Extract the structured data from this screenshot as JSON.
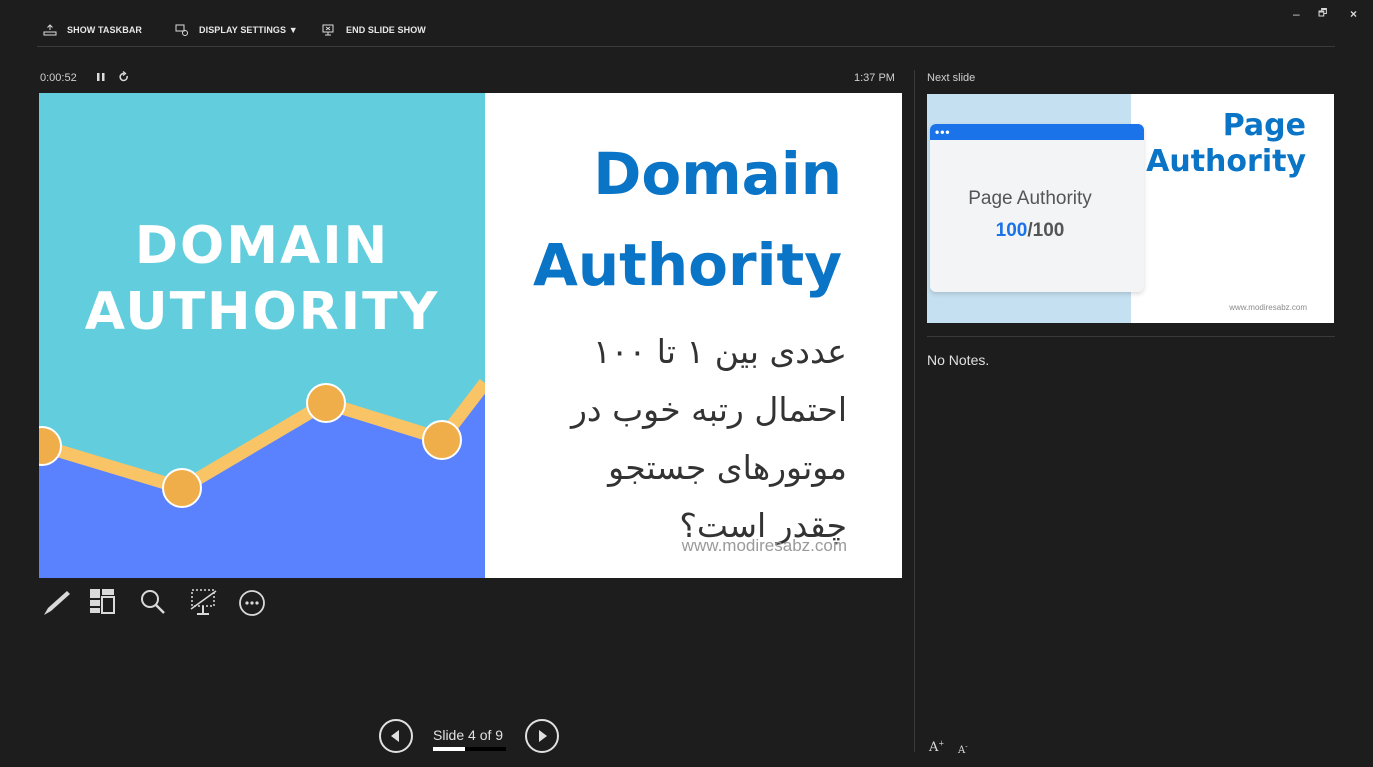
{
  "toolbar": {
    "show_taskbar": "SHOW TASKBAR",
    "display_settings": "DISPLAY SETTINGS ▼",
    "end_slide_show": "END SLIDE SHOW"
  },
  "window": {
    "minimize": "–",
    "restore": "🗗",
    "close": "×"
  },
  "presenter": {
    "elapsed": "0:00:52",
    "clock": "1:37 PM",
    "next_slide_label": "Next slide",
    "notes": "No Notes.",
    "slide_indicator": "Slide 4 of 9",
    "progress_fraction": 0.444
  },
  "current_slide": {
    "left_title_line1": "DOMAIN",
    "left_title_line2": "AUTHORITY",
    "right_title_line1": "Domain",
    "right_title_line2": "Authority",
    "fa_line1": "عددی بین ۱ تا ۱۰۰",
    "fa_line2": "احتمال رتبه خوب در",
    "fa_line3": "موتورهای جستجو",
    "fa_line4": "چقدر است؟",
    "url": "www.modiresabz.com"
  },
  "next_slide": {
    "card_label": "Page Authority",
    "score_value": "100",
    "score_total": "/100",
    "title_line1": "Page",
    "title_line2": "Authority",
    "url": "www.modiresabz.com"
  },
  "colors": {
    "background": "#1d1d1d",
    "slide_teal": "#62cddd",
    "chart_blue": "#5a82ff",
    "chart_line": "#f8c466",
    "chart_dot": "#f0ae4a",
    "title_blue": "#0a74c6"
  },
  "icons": [
    "taskbar-icon",
    "display-settings-icon",
    "end-show-icon",
    "pause-icon",
    "restart-icon",
    "pen-icon",
    "see-all-slides-icon",
    "zoom-icon",
    "black-screen-icon",
    "more-options-icon",
    "prev-icon",
    "next-icon"
  ]
}
